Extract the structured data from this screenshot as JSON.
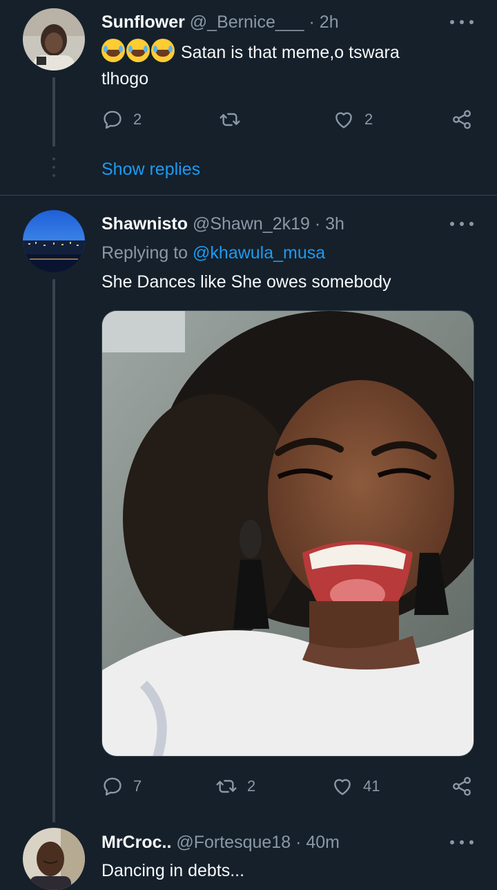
{
  "tweets": [
    {
      "name": "Sunflower",
      "handle": "@_Bernice___",
      "dot": "·",
      "time": "2h",
      "emojis": [
        "face-with-tears-of-joy",
        "face-with-tears-of-joy",
        "face-with-tears-of-joy"
      ],
      "text_line1": "Satan is that meme,o tswara",
      "text_line2": "tlhogo",
      "replies": "2",
      "retweets": "",
      "likes": "2",
      "show_replies": "Show replies"
    },
    {
      "name": "Shawnisto",
      "handle": "@Shawn_2k19",
      "dot": "·",
      "time": "3h",
      "replying_prefix": "Replying to",
      "replying_to": "@khawula_musa",
      "text": "She Dances like She owes somebody",
      "replies": "7",
      "retweets": "2",
      "likes": "41"
    },
    {
      "name": "MrCroc..",
      "handle": "@Fortesque18",
      "dot": "·",
      "time": "40m",
      "text": "Dancing in debts..."
    }
  ],
  "icons": {
    "reply": "reply-icon",
    "retweet": "retweet-icon",
    "like": "heart-icon",
    "share": "share-icon",
    "more": "more-icon"
  },
  "colors": {
    "background": "#15202b",
    "link": "#1d9bf0",
    "secondary_text": "#8b98a5",
    "divider": "#38444d"
  }
}
